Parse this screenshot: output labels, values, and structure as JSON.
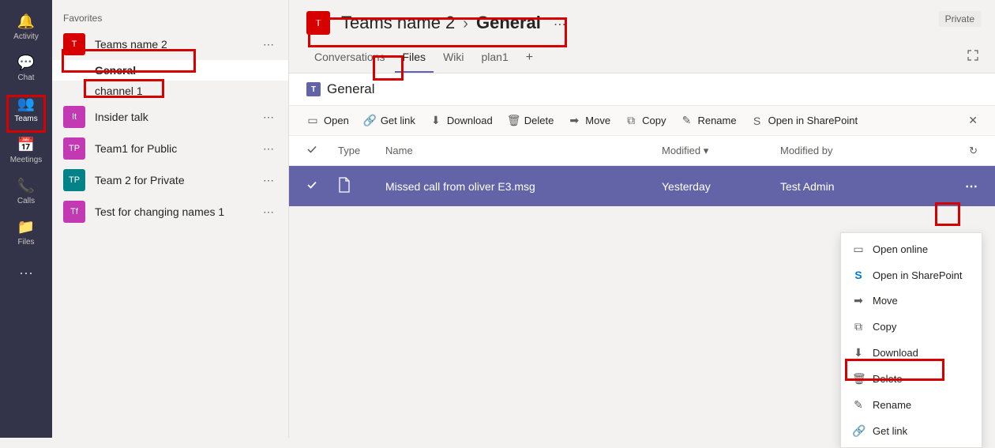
{
  "rail": {
    "items": [
      {
        "id": "activity",
        "label": "Activity",
        "glyph": "🔔"
      },
      {
        "id": "chat",
        "label": "Chat",
        "glyph": "💬"
      },
      {
        "id": "teams",
        "label": "Teams",
        "glyph": "👥"
      },
      {
        "id": "meetings",
        "label": "Meetings",
        "glyph": "📅"
      },
      {
        "id": "calls",
        "label": "Calls",
        "glyph": "📞"
      },
      {
        "id": "files",
        "label": "Files",
        "glyph": "📁"
      },
      {
        "id": "more",
        "label": "",
        "glyph": "⋯"
      }
    ],
    "active": "teams"
  },
  "sidebar": {
    "favorites_label": "Favorites",
    "teams": [
      {
        "name": "Teams name 2",
        "initials": "T",
        "color": "#d60000",
        "channels": [
          "General",
          "channel 1"
        ],
        "selected_channel": "General"
      },
      {
        "name": "Insider talk",
        "initials": "It",
        "color": "#c239b3"
      },
      {
        "name": "Team1 for Public",
        "initials": "TP",
        "color": "#c239b3"
      },
      {
        "name": "Team 2 for Private",
        "initials": "TP",
        "color": "#038387"
      },
      {
        "name": "Test for changing names 1",
        "initials": "Tf",
        "color": "#c239b3"
      }
    ],
    "more_glyph": "⋯"
  },
  "header": {
    "avatar_initial": "T",
    "team": "Teams name 2",
    "separator": "›",
    "channel": "General",
    "more": "⋯",
    "private_label": "Private"
  },
  "tabs": {
    "items": [
      "Conversations",
      "Files",
      "Wiki",
      "plan1"
    ],
    "active": "Files",
    "add_glyph": "+"
  },
  "files": {
    "title": "General",
    "toolbar": {
      "open": "Open",
      "get_link": "Get link",
      "download": "Download",
      "delete": "Delete",
      "move": "Move",
      "copy": "Copy",
      "rename": "Rename",
      "open_sp": "Open in SharePoint"
    },
    "columns": {
      "type": "Type",
      "name": "Name",
      "modified": "Modified",
      "modified_by": "Modified by"
    },
    "rows": [
      {
        "name": "Missed call from oliver E3.msg",
        "modified": "Yesterday",
        "modified_by": "Test Admin",
        "selected": true
      }
    ]
  },
  "ctx": {
    "items": [
      {
        "id": "open-online",
        "label": "Open online",
        "glyph": "▭"
      },
      {
        "id": "open-sp",
        "label": "Open in SharePoint",
        "glyph": "S"
      },
      {
        "id": "move",
        "label": "Move",
        "glyph": "➡"
      },
      {
        "id": "copy",
        "label": "Copy",
        "glyph": "⧉"
      },
      {
        "id": "download",
        "label": "Download",
        "glyph": "⬇"
      },
      {
        "id": "delete",
        "label": "Delete",
        "glyph": "🗑"
      },
      {
        "id": "rename",
        "label": "Rename",
        "glyph": "✎"
      },
      {
        "id": "get-link",
        "label": "Get link",
        "glyph": "🔗"
      }
    ]
  }
}
